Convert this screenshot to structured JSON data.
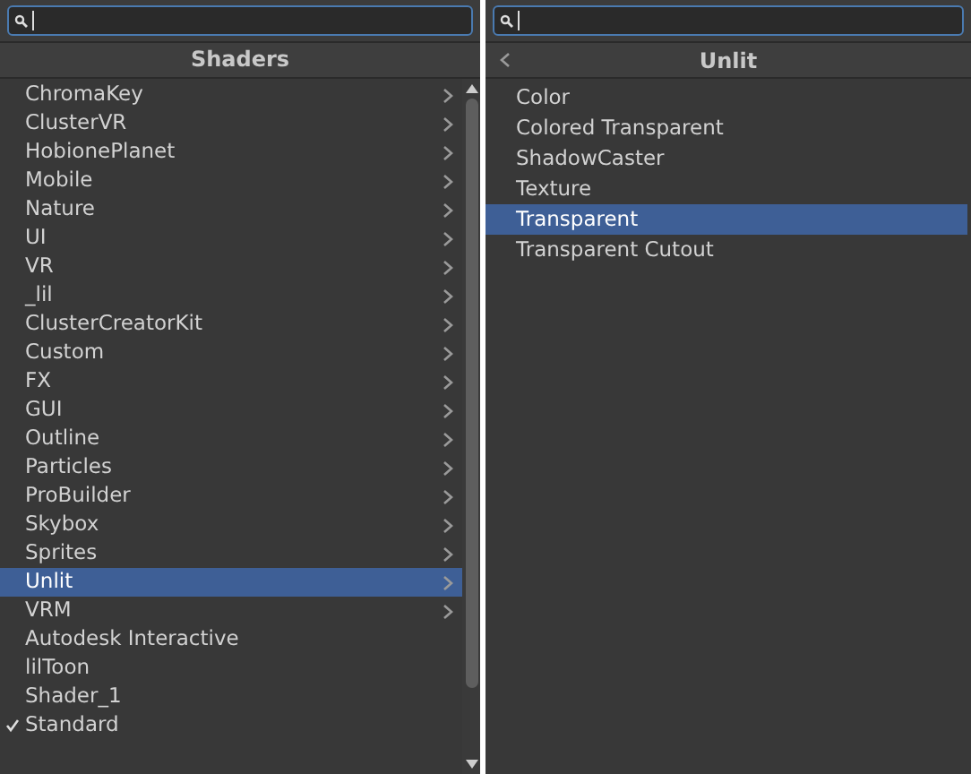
{
  "left_panel": {
    "header": "Shaders",
    "items": [
      {
        "label": "ChromaKey",
        "kind": "submenu",
        "selected": false,
        "checked": false
      },
      {
        "label": "ClusterVR",
        "kind": "submenu",
        "selected": false,
        "checked": false
      },
      {
        "label": "HobionePlanet",
        "kind": "submenu",
        "selected": false,
        "checked": false
      },
      {
        "label": "Mobile",
        "kind": "submenu",
        "selected": false,
        "checked": false
      },
      {
        "label": "Nature",
        "kind": "submenu",
        "selected": false,
        "checked": false
      },
      {
        "label": "UI",
        "kind": "submenu",
        "selected": false,
        "checked": false
      },
      {
        "label": "VR",
        "kind": "submenu",
        "selected": false,
        "checked": false
      },
      {
        "label": "_lil",
        "kind": "submenu",
        "selected": false,
        "checked": false
      },
      {
        "label": "ClusterCreatorKit",
        "kind": "submenu",
        "selected": false,
        "checked": false
      },
      {
        "label": "Custom",
        "kind": "submenu",
        "selected": false,
        "checked": false
      },
      {
        "label": "FX",
        "kind": "submenu",
        "selected": false,
        "checked": false
      },
      {
        "label": "GUI",
        "kind": "submenu",
        "selected": false,
        "checked": false
      },
      {
        "label": "Outline",
        "kind": "submenu",
        "selected": false,
        "checked": false
      },
      {
        "label": "Particles",
        "kind": "submenu",
        "selected": false,
        "checked": false
      },
      {
        "label": "ProBuilder",
        "kind": "submenu",
        "selected": false,
        "checked": false
      },
      {
        "label": "Skybox",
        "kind": "submenu",
        "selected": false,
        "checked": false
      },
      {
        "label": "Sprites",
        "kind": "submenu",
        "selected": false,
        "checked": false
      },
      {
        "label": "Unlit",
        "kind": "submenu",
        "selected": true,
        "checked": false
      },
      {
        "label": "VRM",
        "kind": "submenu",
        "selected": false,
        "checked": false
      },
      {
        "label": "Autodesk Interactive",
        "kind": "leaf",
        "selected": false,
        "checked": false
      },
      {
        "label": "lilToon",
        "kind": "leaf",
        "selected": false,
        "checked": false
      },
      {
        "label": "Shader_1",
        "kind": "leaf",
        "selected": false,
        "checked": false
      },
      {
        "label": "Standard",
        "kind": "leaf",
        "selected": false,
        "checked": true
      }
    ]
  },
  "right_panel": {
    "header": "Unlit",
    "items": [
      {
        "label": "Color",
        "selected": false
      },
      {
        "label": "Colored Transparent",
        "selected": false
      },
      {
        "label": "ShadowCaster",
        "selected": false
      },
      {
        "label": "Texture",
        "selected": false
      },
      {
        "label": "Transparent",
        "selected": true
      },
      {
        "label": "Transparent Cutout",
        "selected": false
      }
    ]
  }
}
